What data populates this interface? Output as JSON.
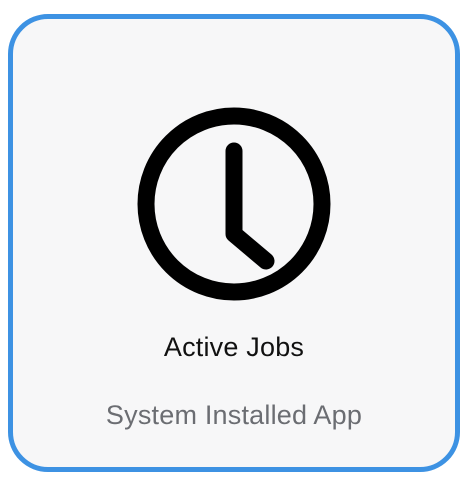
{
  "app_card": {
    "title": "Active Jobs",
    "subtitle": "System Installed App",
    "icon": "clock-icon",
    "colors": {
      "border": "#3d92e3",
      "background": "#f7f7f8",
      "title": "#111111",
      "subtitle": "#6b6d72",
      "icon": "#000000"
    }
  }
}
